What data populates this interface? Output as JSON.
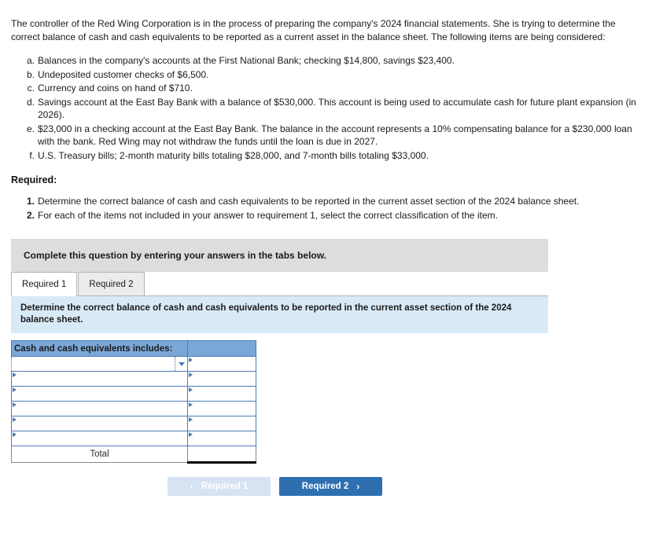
{
  "question": {
    "intro": "The controller of the Red Wing Corporation is in the process of preparing the company's 2024 financial statements. She is trying to determine the correct balance of cash and cash equivalents to be reported as a current asset in the balance sheet. The following items are being considered:",
    "items": [
      {
        "marker": "a.",
        "text": "Balances in the company's accounts at the First National Bank; checking $14,800, savings $23,400."
      },
      {
        "marker": "b.",
        "text": "Undeposited customer checks of $6,500."
      },
      {
        "marker": "c.",
        "text": "Currency and coins on hand of $710."
      },
      {
        "marker": "d.",
        "text": "Savings account at the East Bay Bank with a balance of $530,000. This account is being used to accumulate cash for future plant expansion (in 2026)."
      },
      {
        "marker": "e.",
        "text": "$23,000 in a checking account at the East Bay Bank. The balance in the account represents a 10% compensating balance for a $230,000 loan with the bank. Red Wing may not withdraw the funds until the loan is due in 2027."
      },
      {
        "marker": "f.",
        "text": "U.S. Treasury bills; 2-month maturity bills totaling $28,000, and 7-month bills totaling $33,000."
      }
    ],
    "required_heading": "Required:",
    "requirements": [
      {
        "num": "1.",
        "text": "Determine the correct balance of cash and cash equivalents to be reported in the current asset section of the 2024 balance sheet."
      },
      {
        "num": "2.",
        "text": "For each of the items not included in your answer to requirement 1, select the correct classification of the item."
      }
    ]
  },
  "banner": {
    "text": "Complete this question by entering your answers in the tabs below."
  },
  "tabs": [
    {
      "label": "Required 1",
      "active": true
    },
    {
      "label": "Required 2",
      "active": false
    }
  ],
  "instruction_strip": {
    "text": "Determine the correct balance of cash and cash equivalents to be reported in the current asset section of the 2024 balance sheet."
  },
  "answer_table": {
    "header": {
      "label": "Cash and cash equivalents includes:",
      "value": ""
    },
    "rows": [
      {
        "label": "",
        "value": "",
        "has_dropdown": true
      },
      {
        "label": "",
        "value": "",
        "has_dropdown": false
      },
      {
        "label": "",
        "value": "",
        "has_dropdown": false
      },
      {
        "label": "",
        "value": "",
        "has_dropdown": false
      },
      {
        "label": "",
        "value": "",
        "has_dropdown": false
      },
      {
        "label": "",
        "value": "",
        "has_dropdown": false
      }
    ],
    "total": {
      "label": "Total",
      "value": ""
    }
  },
  "navigation": {
    "prev": {
      "label": "Required 1",
      "chevron": "chevron-left",
      "glyph": "‹",
      "enabled": false
    },
    "next": {
      "label": "Required 2",
      "chevron": "chevron-right",
      "glyph": "›",
      "enabled": true
    }
  },
  "colors": {
    "accent_blue": "#2e6fb0",
    "header_blue": "#7ba7d7",
    "strip_blue": "#d9eaf7",
    "banner_grey": "#dddddd",
    "disabled_blue": "#d7e3f2"
  }
}
